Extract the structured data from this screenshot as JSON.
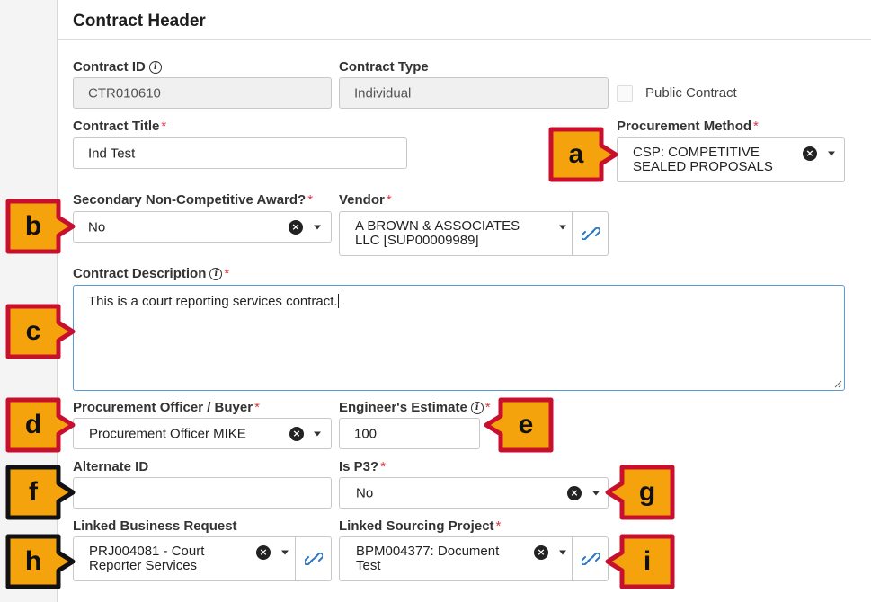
{
  "section": {
    "title": "Contract Header"
  },
  "contract_id": {
    "label": "Contract ID",
    "value": "CTR010610"
  },
  "contract_type": {
    "label": "Contract Type",
    "value": "Individual"
  },
  "public_contract": {
    "label": "Public Contract",
    "checked": false
  },
  "contract_title": {
    "label": "Contract Title",
    "value": "Ind Test"
  },
  "procurement_method": {
    "label": "Procurement Method",
    "value_line1": "CSP: COMPETITIVE",
    "value_line2": "SEALED PROPOSALS"
  },
  "secondary_award": {
    "label": "Secondary Non-Competitive Award?",
    "value": "No"
  },
  "vendor": {
    "label": "Vendor",
    "value_line1": "A BROWN & ASSOCIATES",
    "value_line2": "LLC [SUP00009989]"
  },
  "description": {
    "label": "Contract Description",
    "value": "This is a court reporting services contract."
  },
  "officer": {
    "label": "Procurement Officer / Buyer",
    "value": "Procurement Officer MIKE"
  },
  "estimate": {
    "label": "Engineer's Estimate",
    "value": "100"
  },
  "alternate_id": {
    "label": "Alternate ID",
    "value": ""
  },
  "is_p3": {
    "label": "Is P3?",
    "value": "No"
  },
  "business_request": {
    "label": "Linked Business Request",
    "value_line1": "PRJ004081 - Court",
    "value_line2": "Reporter Services"
  },
  "sourcing_project": {
    "label": "Linked Sourcing Project",
    "value_line1": "BPM004377: Document",
    "value_line2": "Test"
  },
  "callouts": [
    "a",
    "b",
    "c",
    "d",
    "e",
    "f",
    "g",
    "h",
    "i"
  ],
  "colors": {
    "callout_fill": "#f5a30c",
    "callout_border_red": "#c8102e",
    "callout_border_black": "#111111",
    "required": "#d9363e",
    "link": "#2a78c7"
  }
}
